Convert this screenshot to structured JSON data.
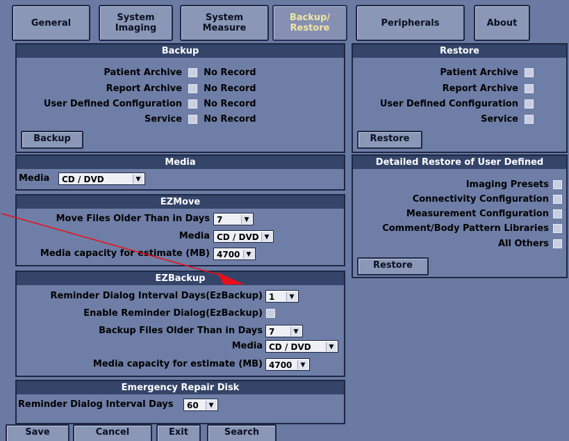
{
  "tabs": [
    {
      "label": "General"
    },
    {
      "label": "System\nImaging"
    },
    {
      "label": "System\nMeasure"
    },
    {
      "label": "Backup/\nRestore"
    },
    {
      "label": "Peripherals"
    },
    {
      "label": "About"
    }
  ],
  "backup": {
    "title": "Backup",
    "rows": [
      {
        "label": "Patient Archive",
        "status": "No Record"
      },
      {
        "label": "Report Archive",
        "status": "No Record"
      },
      {
        "label": "User Defined Configuration",
        "status": "No Record"
      },
      {
        "label": "Service",
        "status": "No Record"
      }
    ],
    "button": "Backup"
  },
  "restore": {
    "title": "Restore",
    "rows": [
      "Patient Archive",
      "Report Archive",
      "User Defined Configuration",
      "Service"
    ],
    "button": "Restore"
  },
  "media": {
    "title": "Media",
    "label": "Media",
    "value": "CD / DVD"
  },
  "detailed": {
    "title": "Detailed Restore of User Defined",
    "rows": [
      "Imaging Presets",
      "Connectivity Configuration",
      "Measurement Configuration",
      "Comment/Body Pattern Libraries",
      "All Others"
    ],
    "button": "Restore"
  },
  "ezmove": {
    "title": "EZMove",
    "older_label": "Move Files Older Than in Days",
    "older_value": "7",
    "media_label": "Media",
    "media_value": "CD / DVD",
    "capacity_label": "Media capacity for estimate (MB)",
    "capacity_value": "4700"
  },
  "ezbackup": {
    "title": "EZBackup",
    "reminder_label": "Reminder Dialog Interval Days(EzBackup)",
    "reminder_value": "1",
    "enable_label": "Enable Reminder Dialog(EzBackup)",
    "older_label": "Backup Files Older Than in Days",
    "older_value": "7",
    "media_label": "Media",
    "media_value": "CD / DVD",
    "capacity_label": "Media capacity for estimate (MB)",
    "capacity_value": "4700"
  },
  "emergency": {
    "title": "Emergency Repair Disk",
    "reminder_label": "Reminder Dialog Interval Days",
    "reminder_value": "60"
  },
  "bottom": {
    "save": "Save",
    "cancel": "Cancel",
    "exit": "Exit",
    "search": "Search"
  },
  "arrow_color": "#e8101a"
}
